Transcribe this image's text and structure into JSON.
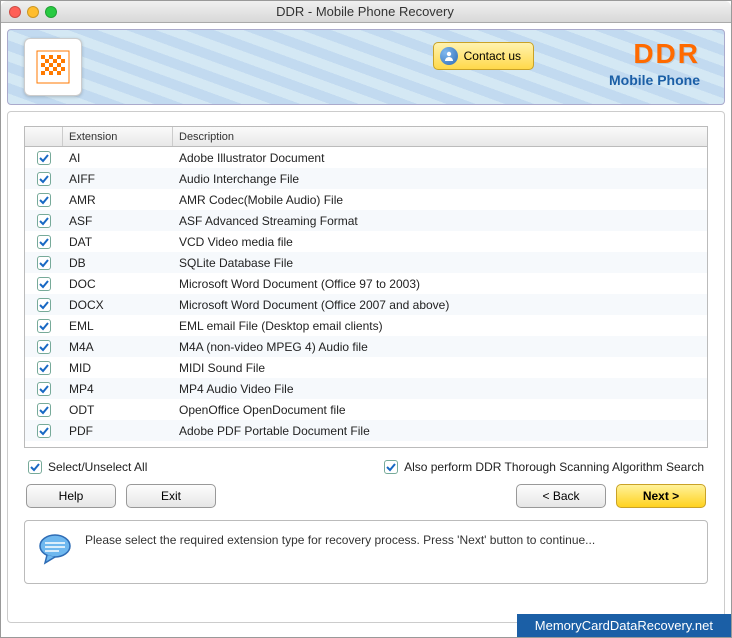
{
  "window": {
    "title": "DDR - Mobile Phone Recovery"
  },
  "banner": {
    "contact_label": "Contact us",
    "brand": "DDR",
    "subtitle": "Mobile Phone"
  },
  "table": {
    "headers": {
      "extension": "Extension",
      "description": "Description"
    },
    "rows": [
      {
        "ext": "AI",
        "desc": "Adobe Illustrator Document"
      },
      {
        "ext": "AIFF",
        "desc": "Audio Interchange File"
      },
      {
        "ext": "AMR",
        "desc": "AMR Codec(Mobile Audio) File"
      },
      {
        "ext": "ASF",
        "desc": "ASF Advanced Streaming Format"
      },
      {
        "ext": "DAT",
        "desc": "VCD Video media file"
      },
      {
        "ext": "DB",
        "desc": "SQLite Database File"
      },
      {
        "ext": "DOC",
        "desc": "Microsoft Word Document (Office 97 to 2003)"
      },
      {
        "ext": "DOCX",
        "desc": "Microsoft Word Document (Office 2007 and above)"
      },
      {
        "ext": "EML",
        "desc": "EML email File (Desktop email clients)"
      },
      {
        "ext": "M4A",
        "desc": "M4A (non-video MPEG 4) Audio file"
      },
      {
        "ext": "MID",
        "desc": "MIDI Sound File"
      },
      {
        "ext": "MP4",
        "desc": "MP4 Audio Video File"
      },
      {
        "ext": "ODT",
        "desc": "OpenOffice OpenDocument file"
      },
      {
        "ext": "PDF",
        "desc": "Adobe PDF Portable Document File"
      }
    ]
  },
  "options": {
    "select_all": "Select/Unselect All",
    "thorough": "Also perform DDR Thorough Scanning Algorithm Search"
  },
  "buttons": {
    "help": "Help",
    "exit": "Exit",
    "back": "< Back",
    "next": "Next >"
  },
  "hint": "Please select the required extension type for recovery process. Press 'Next' button to continue...",
  "footer": "MemoryCardDataRecovery.net"
}
